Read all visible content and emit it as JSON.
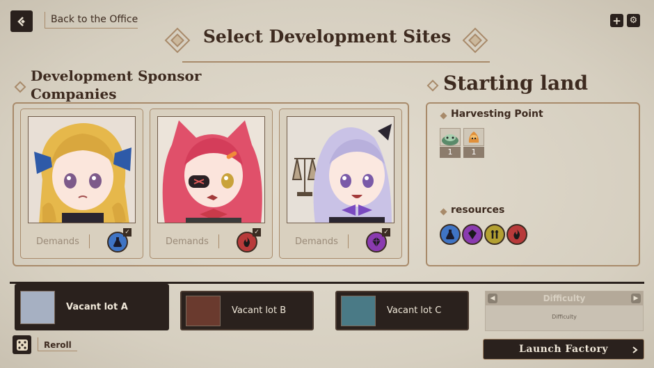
{
  "top_bar": {
    "back_label": "Back to the Office",
    "plus_glyph": "+",
    "gear_glyph": "⚙"
  },
  "header": {
    "title": "Select Development Sites"
  },
  "sponsors": {
    "heading": "Development Sponsor Companies",
    "cards": [
      {
        "demands_label": "Demands",
        "resource": "flask-icon",
        "color": "#3f74c4"
      },
      {
        "demands_label": "Demands",
        "resource": "flame-icon",
        "color": "#b83a3a"
      },
      {
        "demands_label": "Demands",
        "resource": "crystal-icon",
        "color": "#8a3bb0"
      }
    ]
  },
  "starting_land": {
    "heading": "Starting land",
    "harvest_heading": "Harvesting Point",
    "harvest_items": [
      {
        "icon": "slime-creature-icon",
        "count": "1"
      },
      {
        "icon": "blob-creature-icon",
        "count": "1"
      }
    ],
    "resources_heading": "resources",
    "resources": [
      {
        "icon": "flask-icon",
        "color": "#3f74c4"
      },
      {
        "icon": "crystal-icon",
        "color": "#8a3bb0"
      },
      {
        "icon": "wheat-icon",
        "color": "#b3a032"
      },
      {
        "icon": "flame-icon",
        "color": "#b83a3a"
      }
    ]
  },
  "lots": [
    {
      "name": "Vacant lot A",
      "selected": true
    },
    {
      "name": "Vacant lot B",
      "selected": false
    },
    {
      "name": "Vacant lot C",
      "selected": false
    }
  ],
  "difficulty": {
    "title": "Difficulty",
    "value": "Difficulty"
  },
  "reroll_label": "Reroll",
  "launch_label": "Launch Factory"
}
